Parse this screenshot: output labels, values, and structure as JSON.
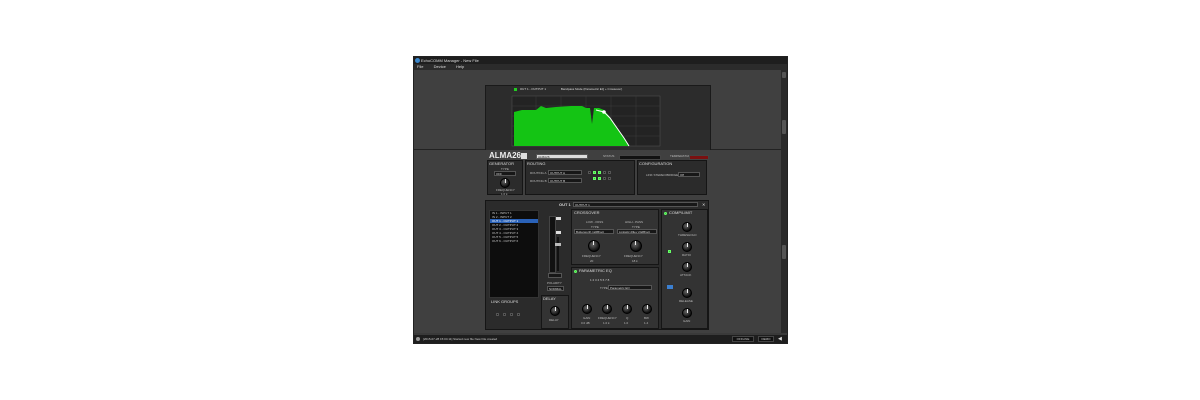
{
  "window": {
    "title": "EchoCOMM Manager - New File"
  },
  "menu": [
    "File",
    "Device",
    "Help"
  ],
  "graph": {
    "tab_label": "OUT 1 - OUTPUT 1",
    "legend_text": "Bandpass Mode (Parametric EQ + Crossover)",
    "fill_color": "#14c414",
    "line_color": "#ffffff"
  },
  "device": {
    "model": "ALMA26",
    "name_field": "ALMA26",
    "status_label_1": "STATUS",
    "status_label_2": "TEMPERATURE"
  },
  "generator": {
    "title": "GENERATOR",
    "type_label": "TYPE",
    "type_value": "OFF",
    "freq_label": "FREQUENCY",
    "freq_value": "1.0 k"
  },
  "routing": {
    "title": "ROUTING",
    "rows": [
      {
        "label": "ROUTING A",
        "value": "OUTPUT A"
      },
      {
        "label": "ROUTING B",
        "value": "OUTPUT B"
      }
    ]
  },
  "configuration": {
    "title": "CONFIGURATION",
    "label": "LINK STEREO/BRIDGE",
    "value": "Off"
  },
  "channels": {
    "items": [
      "IN 1 - INPUT 1",
      "IN 2 - INPUT 2",
      "OUT 1 - OUTPUT 1",
      "OUT 2 - OUTPUT 2",
      "OUT 3 - OUTPUT 3",
      "OUT 4 - OUTPUT 4",
      "OUT 5 - OUTPUT 5",
      "OUT 6 - OUTPUT 6"
    ],
    "selected_index": 2,
    "link_groups_label": "LINK GROUPS"
  },
  "channel_strip": {
    "out_label": "OUT 1",
    "name_value": "OUTPUT 1",
    "polarity_label": "POLARITY",
    "polarity_value": "NORMAL",
    "delay_title": "DELAY",
    "delay_knob_label": "DELAY"
  },
  "crossover": {
    "title": "CROSSOVER",
    "lowpass_title": "LOW - PASS",
    "highpass_title": "HIGH - PASS",
    "type_label": "TYPE",
    "lowpass_type": "Butterworth 12dB/oct",
    "highpass_type": "Linkwitz-Riley 24dB/oct",
    "freq_label": "FREQUENCY",
    "lowpass_freq": "20",
    "highpass_freq": "18 k"
  },
  "peq": {
    "title": "PARAMETRIC EQ",
    "bands": [
      "1",
      "2",
      "3",
      "4",
      "5",
      "6",
      "7",
      "8"
    ],
    "type_label": "TYPE",
    "type_value": "Parametric EQ",
    "knob_labels": [
      "GAIN",
      "FREQUENCY",
      "Q",
      "BW"
    ],
    "knob_values": [
      "0.0 dB",
      "1.0 k",
      "1.0",
      "1.4"
    ]
  },
  "limiter": {
    "title": "COMP/LIMIT",
    "knobs": [
      "THRESHOLD",
      "RATIO",
      "ATTACK",
      "RELEASE",
      "GAIN"
    ]
  },
  "status": {
    "message": "[2015-07-28 15:04:11] Started new file New File created",
    "box1": "OFFLINE",
    "box2": "DEMO"
  }
}
